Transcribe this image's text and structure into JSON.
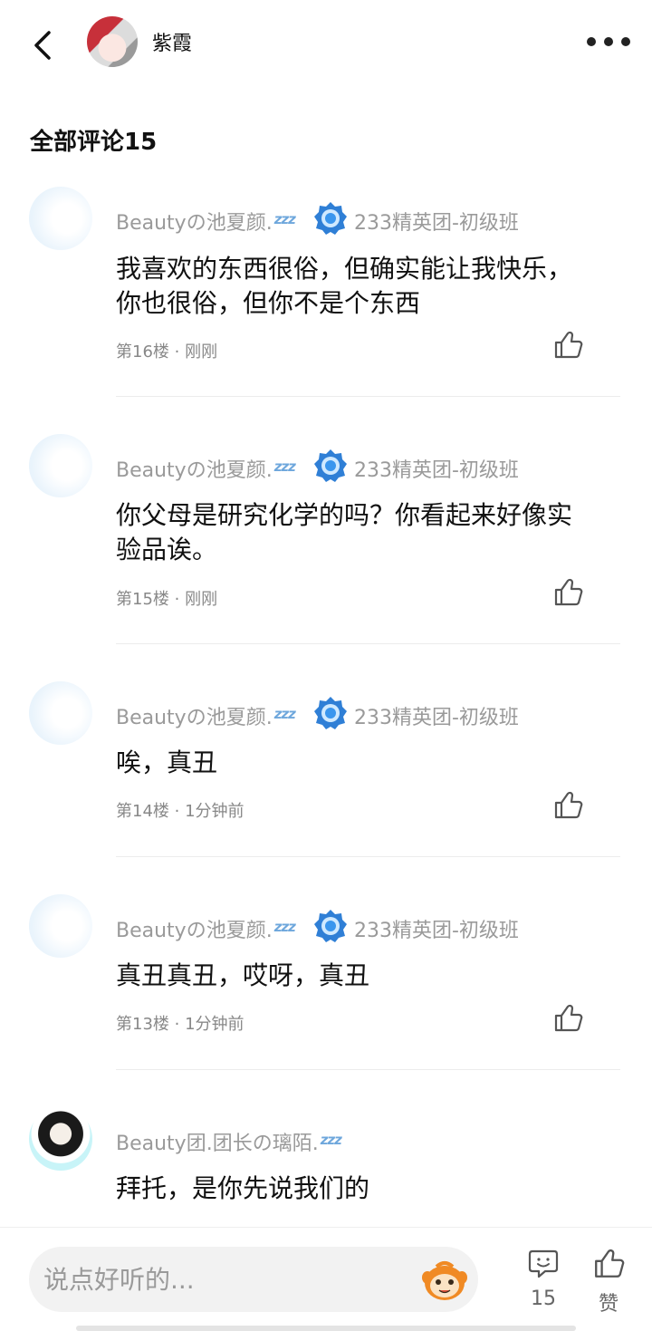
{
  "header": {
    "user_name": "紫霞"
  },
  "comments_title": "全部评论15",
  "comments": [
    {
      "author": "Beautyの池夏颜.",
      "badge": "233精英团-初级班",
      "text": "我喜欢的东西很俗，但确实能让我快乐，你也很俗，但你不是个东西",
      "meta": "第16楼 · 刚刚"
    },
    {
      "author": "Beautyの池夏颜.",
      "badge": "233精英团-初级班",
      "text": "你父母是研究化学的吗？你看起来好像实验品诶。",
      "meta": "第15楼 · 刚刚"
    },
    {
      "author": "Beautyの池夏颜.",
      "badge": "233精英团-初级班",
      "text": "唉，真丑",
      "meta": "第14楼 · 1分钟前"
    },
    {
      "author": "Beautyの池夏颜.",
      "badge": "233精英团-初级班",
      "text": "真丑真丑，哎呀，真丑",
      "meta": "第13楼 · 1分钟前"
    },
    {
      "author": "Beauty团.团长の璃陌.",
      "text": "拜托，是你先说我们的"
    }
  ],
  "sleep_mark": "zzz",
  "bottom_bar": {
    "input_placeholder": "说点好听的...",
    "comment_count": "15",
    "like_label": "赞"
  },
  "icons": {
    "back": "chevron-left-icon",
    "more": "more-dots-icon",
    "badge": "blue-gem-badge-icon",
    "like": "thumbs-up-icon",
    "comment": "comment-bubble-icon",
    "emoji": "monkey-emoji-icon"
  }
}
